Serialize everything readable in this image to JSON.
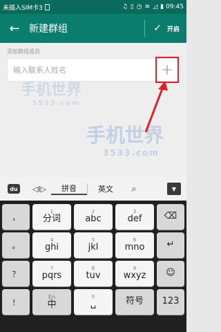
{
  "statusbar": {
    "carrier": "未插入SIM卡3",
    "time": "09:45"
  },
  "appbar": {
    "back_icon": "arrow-left-icon",
    "title": "新建群组",
    "start_label": "开启"
  },
  "content": {
    "section_label": "添加群组成员",
    "search_placeholder": "输入联系人姓名"
  },
  "keyboard": {
    "logo_text": "du",
    "cursor_label": "◁I▷",
    "modes": [
      "拼音",
      "英文"
    ],
    "keys": {
      "comma": "，",
      "period": "。",
      "question": "？",
      "exclaim": "！",
      "fenci": "分词",
      "abc": "abc",
      "def": "def",
      "ghi": "ghi",
      "jkl": "jkl",
      "mno": "mno",
      "pqrs": "pqrs",
      "tuv": "tuv",
      "wxyz": "wxyz",
      "symbol": "符号",
      "numbers": "123",
      "lang": "中",
      "lang_sub": "En",
      "n1": "1",
      "n2": "2",
      "n3": "3",
      "n4": "4",
      "n5": "5",
      "n6": "6",
      "n7": "7",
      "n8": "8",
      "n9": "9",
      "n0": "0",
      "hash": "#",
      "at": "@"
    }
  },
  "colors": {
    "statusbar": "#0a6b5d",
    "appbar": "#0b7d6d",
    "highlight": "#e0202a"
  }
}
